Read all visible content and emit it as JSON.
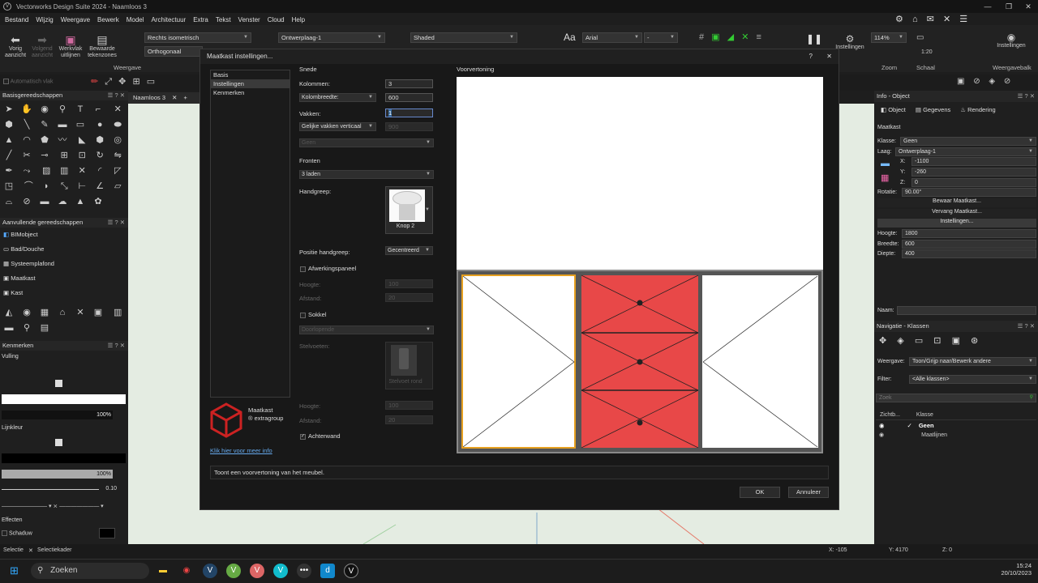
{
  "app": {
    "title": "Vectorworks Design Suite 2024 - Naamloos 3"
  },
  "menu": [
    "Bestand",
    "Wijzig",
    "Weergave",
    "Bewerk",
    "Model",
    "Architectuur",
    "Extra",
    "Tekst",
    "Venster",
    "Cloud",
    "Help"
  ],
  "toolbar": {
    "vorig": "Vorig aanzicht",
    "volgend": "Volgend aanzicht",
    "werkvlak": "Werkvlak uitlijnen",
    "bewaarde": "Bewaarde tekenzones",
    "view_combo": "Rechts isometrisch",
    "projection_combo": "Orthogonaal",
    "layer_combo": "Ontwerplaag-1",
    "render_combo": "Shaded",
    "font_combo": "Arial",
    "size_combo": "-",
    "weergave": "Weergave",
    "instellingen": "Instellingen",
    "zoom_value": "114%",
    "zoom": "Zoom",
    "scale_value": "1:20",
    "schaal": "Schaal",
    "instellingen2": "Instellingen",
    "weergavebalk": "Weergavebalk",
    "automatisch": "Automatisch vlak",
    "tab": "Naamloos 3"
  },
  "left": {
    "basis_title": "Basisgereedschappen",
    "aanvullend_title": "Aanvullende gereedschappen",
    "aanvullend_items": [
      "BIMobject",
      "Bad/Douche",
      "Systeemplafond",
      "Maatkast",
      "Kast"
    ],
    "kenmerken_title": "Kenmerken",
    "vulling": "Vulling",
    "vulling_pct": "100%",
    "lijnkleur": "Lijnkleur",
    "lijn_pct": "100%",
    "lijndikte": "0.10",
    "effecten": "Effecten",
    "schaduw": "Schaduw"
  },
  "dialog": {
    "title": "Maatkast instellingen...",
    "nav": [
      "Basis",
      "Instellingen",
      "Kenmerken"
    ],
    "snede": "Snede",
    "kolommen_label": "Kolommen:",
    "kolommen": "3",
    "kolombreedte_dd": "Kolombreedte:",
    "kolombreedte": "600",
    "vakken_label": "Vakken:",
    "vakken": "1",
    "gelijke_dd": "Gelijke vakken verticaal",
    "gelijke_val": "900",
    "geen_dd": "Geen",
    "fronten": "Fronten",
    "fronten_dd": "3 laden",
    "handgreep": "Handgreep:",
    "knop": "Knop 2",
    "positie_label": "Positie handgreep:",
    "positie_dd": "Gecentreerd",
    "afwerking": "Afwerkingspaneel",
    "hoogte": "Hoogte:",
    "hoogte_val": "100",
    "afstand": "Afstand:",
    "afstand_val": "20",
    "sokkel": "Sokkel",
    "doorlopende": "Doorlopende",
    "stelvoeten": "Stelvoeten:",
    "stelvoet": "Stelvoet rond",
    "hoogte2_val": "100",
    "afstand2_val": "20",
    "achterwand": "Achterwand",
    "voorvertoning": "Voorvertoning",
    "logo_line1": "Maatkast",
    "logo_line2": "® extragroup",
    "link": "Klik hier voor meer info",
    "status": "Toont een voorvertoning van het meubel.",
    "ok": "OK",
    "annuleer": "Annuleer",
    "help": "?",
    "close": "✕"
  },
  "right": {
    "info_title": "Info - Object",
    "tabs": [
      "Object",
      "Gegevens",
      "Rendering"
    ],
    "type": "Maatkast",
    "klasse_label": "Klasse:",
    "klasse": "Geen",
    "laag_label": "Laag:",
    "laag": "Ontwerplaag-1",
    "x_label": "X:",
    "x": "-1100",
    "y_label": "Y:",
    "y": "-260",
    "z_label": "Z:",
    "z": "0",
    "rotatie_label": "Rotatie:",
    "rotatie": "90.00°",
    "btn1": "Bewaar Maatkast...",
    "btn2": "Vervang Maatkast...",
    "btn3": "Instellingen...",
    "hoogte_label": "Hoogte:",
    "hoogte": "1800",
    "breedte_label": "Breedte:",
    "breedte": "600",
    "diepte_label": "Diepte:",
    "diepte": "400",
    "naam_label": "Naam:",
    "nav_title": "Navigatie - Klassen",
    "weergave_label": "Weergave:",
    "weergave": "Toon/Grijp naar/Bewerk andere",
    "filter_label": "Filter:",
    "filter": "<Alle klassen>",
    "zoek": "Zoek",
    "col1": "Zichtb...",
    "col2": "Klasse",
    "row1": "Geen",
    "row2": "Maatlijnen"
  },
  "status": {
    "tool": "Selectie",
    "tool2": "Selectiekader",
    "x": "X: -105",
    "y": "Y: 4170",
    "z": "Z: 0"
  },
  "taskbar": {
    "search": "Zoeken",
    "time": "15:24",
    "date": "20/10/2023"
  }
}
